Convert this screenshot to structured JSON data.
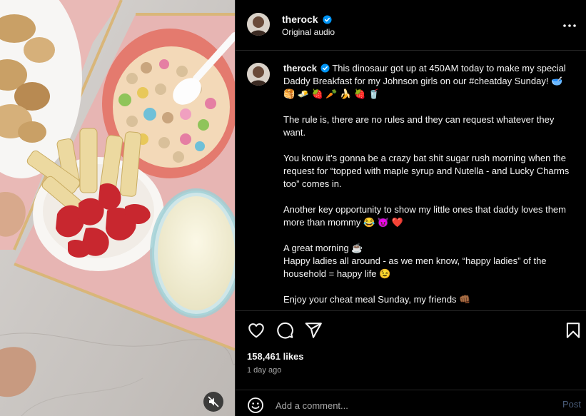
{
  "colors": {
    "verified": "#0095f6",
    "background": "#000000",
    "muted_text": "#a8a8a8",
    "heart": "#e0245e"
  },
  "header": {
    "username": "therock",
    "subtitle": "Original audio",
    "more_icon": "more-horizontal-icon"
  },
  "caption": {
    "username": "therock",
    "paragraphs": [
      "This dinosaur got up at 450AM today to make my special Daddy Breakfast for my Johnson girls on our #cheatday Sunday! 🥣 🥞 🧈 🍓 🥕 🍌 🍓 🥤",
      "The rule is, there are no rules and they can request whatever they want.",
      "You know it’s gonna be a crazy bat shit sugar rush morning when the request for “topped with maple syrup and Nutella - and Lucky Charms too” comes in.",
      "Another key opportunity to show my little ones that daddy loves them more than mommy 😂 😈 ❤️",
      "A great morning ☕",
      "Happy ladies all around - as we men know, “happy ladies” of the household = happy life 😉",
      "Enjoy your cheat meal Sunday, my friends 👊🏾"
    ]
  },
  "actions": {
    "like_icon": "heart-icon",
    "comment_icon": "comment-icon",
    "share_icon": "share-icon",
    "save_icon": "bookmark-icon"
  },
  "likes": "158,461 likes",
  "time": "1 day ago",
  "comment": {
    "placeholder": "Add a comment...",
    "post_label": "Post"
  },
  "media": {
    "mute_icon": "muted-speaker-icon"
  }
}
